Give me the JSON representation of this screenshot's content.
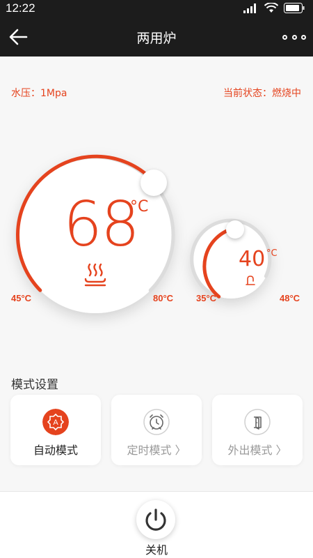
{
  "status_bar": {
    "time": "12:22"
  },
  "nav": {
    "title": "两用炉"
  },
  "info": {
    "pressure": "水压：1Mpa",
    "state": "当前状态：燃烧中"
  },
  "heating": {
    "temperature": "68",
    "unit": "°C",
    "min": "45°C",
    "max": "80°C",
    "level": 0.65,
    "icon": "radiator-icon"
  },
  "hot_water": {
    "temperature": "40",
    "unit": "°C",
    "min": "35°C",
    "max": "48°C",
    "level": 0.4,
    "icon": "faucet-icon"
  },
  "modes": {
    "title": "模式设置",
    "items": [
      {
        "label": "自动模式",
        "icon": "auto-mode-icon",
        "active": true
      },
      {
        "label": "定时模式 〉",
        "icon": "alarm-clock-icon",
        "active": false
      },
      {
        "label": "外出模式 〉",
        "icon": "door-exit-icon",
        "active": false
      }
    ]
  },
  "power": {
    "label": "关机"
  },
  "colors": {
    "accent": "#e5431e",
    "inactive": "#999999",
    "nav_bg": "#1c1c1c"
  }
}
